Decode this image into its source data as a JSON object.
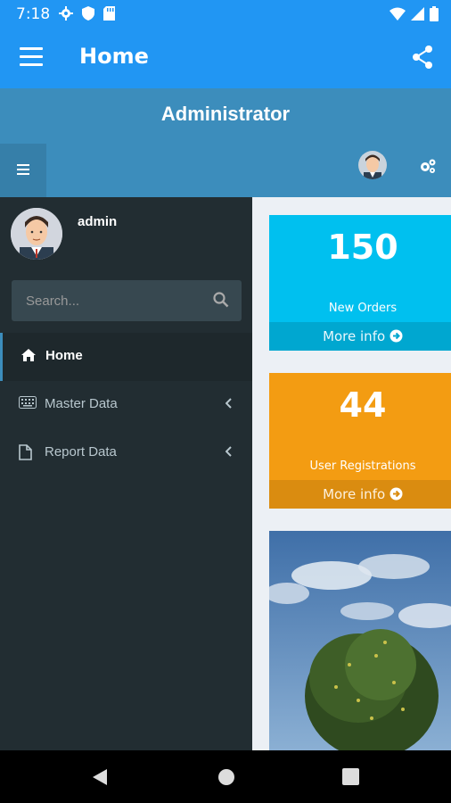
{
  "status_bar": {
    "time": "7:18",
    "left_icons": [
      "settings-icon",
      "shield-icon",
      "sd-card-icon"
    ],
    "right_icons": [
      "wifi-icon",
      "signal-icon",
      "battery-icon"
    ]
  },
  "app_bar": {
    "title": "Home",
    "menu_icon": "hamburger-icon",
    "share_icon": "share-icon",
    "color": "#2196f3"
  },
  "admin_header": {
    "title": "Administrator",
    "color": "#3c8dbc"
  },
  "sidebar": {
    "user": {
      "name": "admin"
    },
    "search": {
      "placeholder": "Search..."
    },
    "items": [
      {
        "label": "Home",
        "icon": "home-icon",
        "active": true
      },
      {
        "label": "Master Data",
        "icon": "keyboard-icon",
        "active": false
      },
      {
        "label": "Report Data",
        "icon": "file-icon",
        "active": false
      }
    ]
  },
  "boxes": [
    {
      "value": "150",
      "label": "New Orders",
      "footer": "More info",
      "color": "#00c0ef"
    },
    {
      "value": "44",
      "label": "User Registrations",
      "footer": "More info",
      "color": "#f39c12"
    }
  ]
}
